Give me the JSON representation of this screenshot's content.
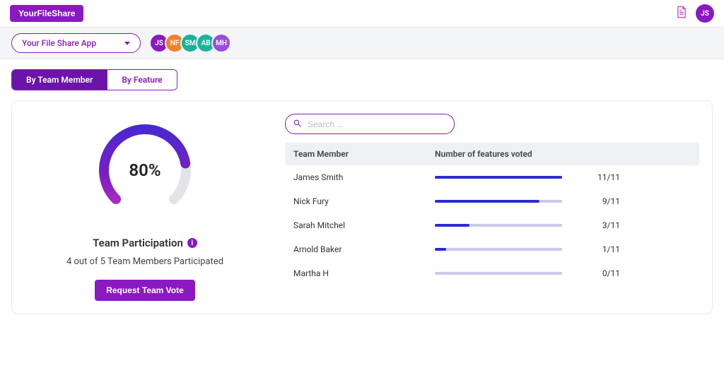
{
  "brand": "YourFileShare",
  "user_avatar": {
    "initials": "JS",
    "color": "#8b19c2"
  },
  "app_selector": {
    "label": "Your File Share App"
  },
  "project_avatars": [
    {
      "initials": "JS",
      "color": "#8b19c2"
    },
    {
      "initials": "NF",
      "color": "#f08228"
    },
    {
      "initials": "SM",
      "color": "#15b39a"
    },
    {
      "initials": "AB",
      "color": "#19b59d"
    },
    {
      "initials": "MH",
      "color": "#9b4edd"
    }
  ],
  "tabs": {
    "by_member": "By Team Member",
    "by_feature": "By Feature"
  },
  "participation": {
    "percent_label": "80%",
    "title": "Team Participation",
    "subtitle": "4 out of 5 Team Members Participated",
    "button": "Request Team Vote"
  },
  "search": {
    "placeholder": "Search ..."
  },
  "table": {
    "head_name": "Team Member",
    "head_votes": "Number of features voted",
    "rows": [
      {
        "name": "James Smith",
        "value": "11/11",
        "pct": 100
      },
      {
        "name": "Nick Fury",
        "value": "9/11",
        "pct": 82
      },
      {
        "name": "Sarah Mitchel",
        "value": "3/11",
        "pct": 27
      },
      {
        "name": "Arnold Baker",
        "value": "1/11",
        "pct": 9
      },
      {
        "name": "Martha H",
        "value": "0/11",
        "pct": 0
      }
    ]
  },
  "chart_data": {
    "type": "bar",
    "title": "Number of features voted",
    "categories": [
      "James Smith",
      "Nick Fury",
      "Sarah Mitchel",
      "Arnold Baker",
      "Martha H"
    ],
    "values": [
      11,
      9,
      3,
      1,
      0
    ],
    "max": 11,
    "gauge": {
      "type": "gauge",
      "value": 80,
      "label": "Team Participation"
    }
  }
}
